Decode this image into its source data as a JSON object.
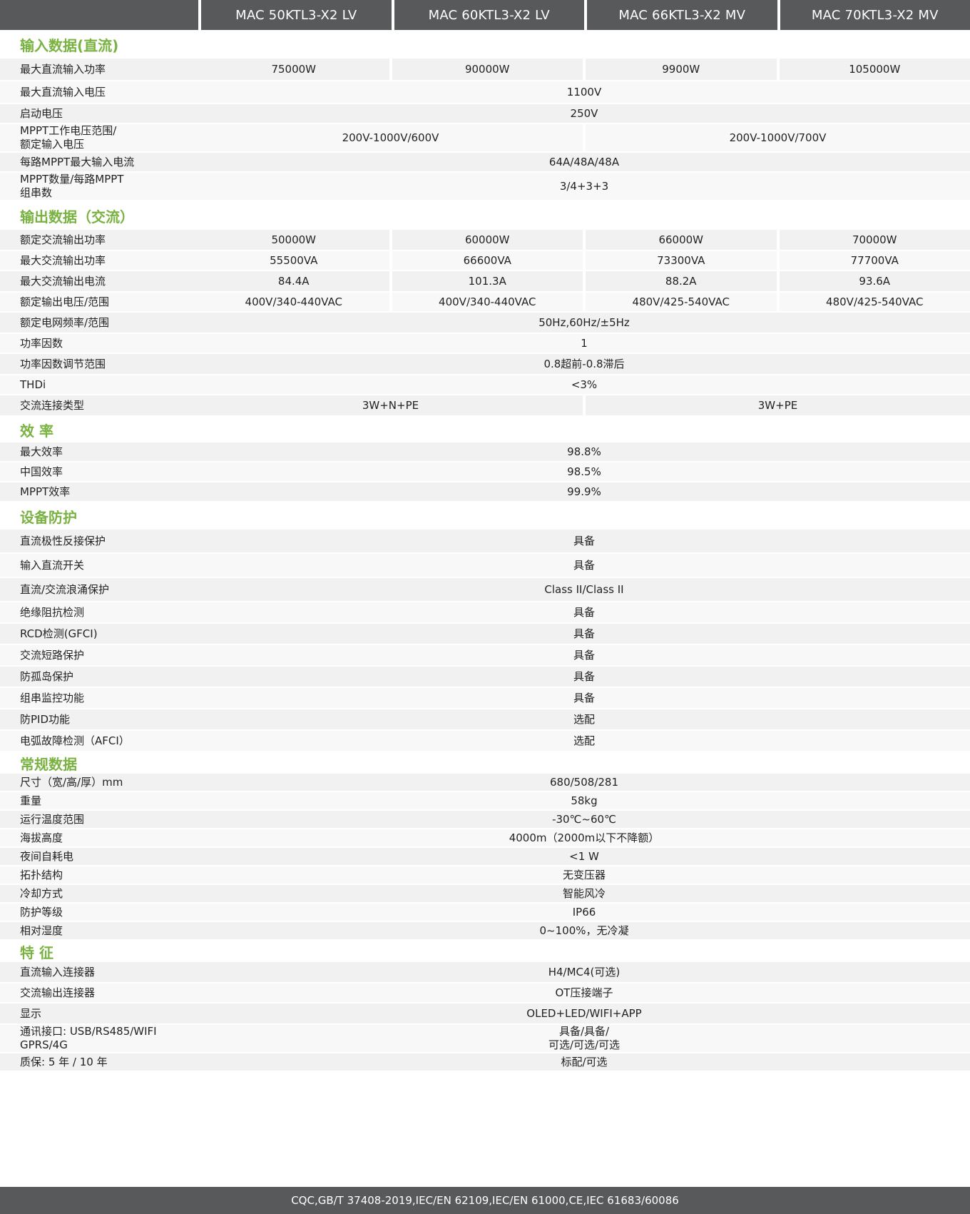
{
  "header": {
    "models": [
      "MAC 50KTL3-X2 LV",
      "MAC 60KTL3-X2 LV",
      "MAC 66KTL3-X2 MV",
      "MAC 70KTL3-X2 MV"
    ]
  },
  "sections": [
    {
      "title": "输入数据(直流)",
      "rows": [
        {
          "label": "最大直流输入功率",
          "values": [
            "75000W",
            "90000W",
            "9900W",
            "105000W"
          ]
        },
        {
          "label": "最大直流输入电压",
          "values": [
            "1100V"
          ]
        },
        {
          "label": "启动电压",
          "values": [
            "250V"
          ]
        },
        {
          "label": "MPPT工作电压范围/\n额定输入电压",
          "values": [
            "200V-1000V/600V",
            "200V-1000V/700V"
          ]
        },
        {
          "label": "每路MPPT最大输入电流",
          "values": [
            "64A/48A/48A"
          ]
        },
        {
          "label": "MPPT数量/每路MPPT\n组串数",
          "values": [
            "3/4+3+3"
          ]
        }
      ]
    },
    {
      "title": "输出数据（交流）",
      "rows": [
        {
          "label": "额定交流输出功率",
          "values": [
            "50000W",
            "60000W",
            "66000W",
            "70000W"
          ]
        },
        {
          "label": "最大交流输出功率",
          "values": [
            "55500VA",
            "66600VA",
            "73300VA",
            "77700VA"
          ]
        },
        {
          "label": "最大交流输出电流",
          "values": [
            "84.4A",
            "101.3A",
            "88.2A",
            "93.6A"
          ]
        },
        {
          "label": "额定输出电压/范围",
          "values": [
            "400V/340-440VAC",
            "400V/340-440VAC",
            "480V/425-540VAC",
            "480V/425-540VAC"
          ]
        },
        {
          "label": "额定电网频率/范围",
          "values": [
            "50Hz,60Hz/±5Hz"
          ]
        },
        {
          "label": "功率因数",
          "values": [
            "1"
          ]
        },
        {
          "label": "功率因数调节范围",
          "values": [
            "0.8超前-0.8滞后"
          ]
        },
        {
          "label": "THDi",
          "values": [
            "<3%"
          ]
        },
        {
          "label": "交流连接类型",
          "values": [
            "3W+N+PE",
            "3W+PE"
          ]
        }
      ]
    },
    {
      "title": "效  率",
      "rows": [
        {
          "label": "最大效率",
          "values": [
            "98.8%"
          ]
        },
        {
          "label": "中国效率",
          "values": [
            "98.5%"
          ]
        },
        {
          "label": "MPPT效率",
          "values": [
            "99.9%"
          ]
        }
      ]
    },
    {
      "title": "设备防护",
      "rows": [
        {
          "label": "直流极性反接保护",
          "values": [
            "具备"
          ]
        },
        {
          "label": "输入直流开关",
          "values": [
            "具备"
          ]
        },
        {
          "label": "直流/交流浪涌保护",
          "values": [
            "Class II/Class II"
          ]
        },
        {
          "label": "绝缘阻抗检测",
          "values": [
            "具备"
          ]
        },
        {
          "label": "RCD检测(GFCI)",
          "values": [
            "具备"
          ]
        },
        {
          "label": "交流短路保护",
          "values": [
            "具备"
          ]
        },
        {
          "label": "防孤岛保护",
          "values": [
            "具备"
          ]
        },
        {
          "label": "组串监控功能",
          "values": [
            "具备"
          ]
        },
        {
          "label": "防PID功能",
          "values": [
            "选配"
          ]
        },
        {
          "label": "电弧故障检测（AFCI）",
          "values": [
            "选配"
          ]
        }
      ]
    },
    {
      "title": "常规数据",
      "rows": [
        {
          "label": "尺寸（宽/高/厚）mm",
          "values": [
            "680/508/281"
          ]
        },
        {
          "label": "重量",
          "values": [
            "58kg"
          ]
        },
        {
          "label": "运行温度范围",
          "values": [
            "-30℃~60℃"
          ]
        },
        {
          "label": "海拔高度",
          "values": [
            "4000m（2000m以下不降额）"
          ]
        },
        {
          "label": "夜间自耗电",
          "values": [
            "<1 W"
          ]
        },
        {
          "label": "拓扑结构",
          "values": [
            "无变压器"
          ]
        },
        {
          "label": "冷却方式",
          "values": [
            "智能风冷"
          ]
        },
        {
          "label": "防护等级",
          "values": [
            "IP66"
          ]
        },
        {
          "label": "相对湿度",
          "values": [
            "0~100%，无冷凝"
          ]
        }
      ]
    },
    {
      "title": "特  征",
      "rows": [
        {
          "label": "直流输入连接器",
          "values": [
            "H4/MC4(可选)"
          ]
        },
        {
          "label": "交流输出连接器",
          "values": [
            "OT压接端子"
          ]
        },
        {
          "label": "显示",
          "values": [
            "OLED+LED/WIFI+APP"
          ]
        },
        {
          "label": "通讯接口: USB/RS485/WIFI\nGPRS/4G",
          "values": [
            "具备/具备/\n可选/可选/可选"
          ]
        },
        {
          "label": "质保: 5 年 / 10 年",
          "values": [
            "标配/可选"
          ]
        }
      ]
    }
  ],
  "footer": {
    "certifications": "CQC,GB/T 37408-2019,IEC/EN 62109,IEC/EN 61000,CE,IEC 61683/60086"
  }
}
